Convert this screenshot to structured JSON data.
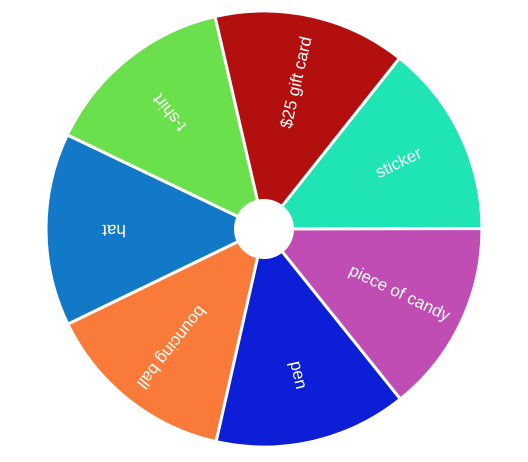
{
  "wheel": {
    "segments": [
      {
        "label": "$25 gift card",
        "color": "#b30f0f"
      },
      {
        "label": "sticker",
        "color": "#1ee5b3"
      },
      {
        "label": "piece of candy",
        "color": "#bf4db3"
      },
      {
        "label": "pen",
        "color": "#0c1ed6"
      },
      {
        "label": "bouncing ball",
        "color": "#fa7a3a"
      },
      {
        "label": "hat",
        "color": "#1279c9"
      },
      {
        "label": "t-shirt",
        "color": "#6be04d"
      }
    ],
    "hub_color": "#ffffff",
    "label_color": "#ffffff"
  }
}
